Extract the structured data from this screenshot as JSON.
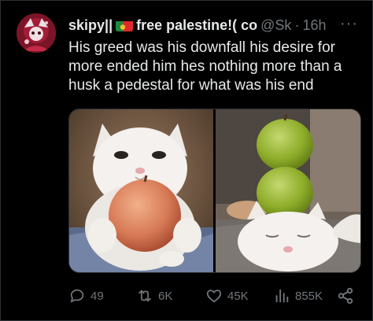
{
  "post": {
    "display_name": "skipy||",
    "display_name_suffix": "free palestine!( co",
    "handle": "@Sk",
    "separator": "·",
    "timestamp": "16h",
    "more_glyph": "···",
    "text": "His greed was his downfall his desire for more ended him hes nothing more than a husk a pedestal for what was his end"
  },
  "media": {
    "images": [
      {
        "icon": "cat-holding-apple-photo"
      },
      {
        "icon": "cat-with-apples-on-head-photo"
      }
    ]
  },
  "actions": {
    "replies": "49",
    "reposts": "6K",
    "likes": "45K",
    "views": "855K"
  },
  "colors": {
    "background": "#000000",
    "text": "#e7e9ea",
    "muted": "#71767b",
    "border": "#2f3336"
  }
}
